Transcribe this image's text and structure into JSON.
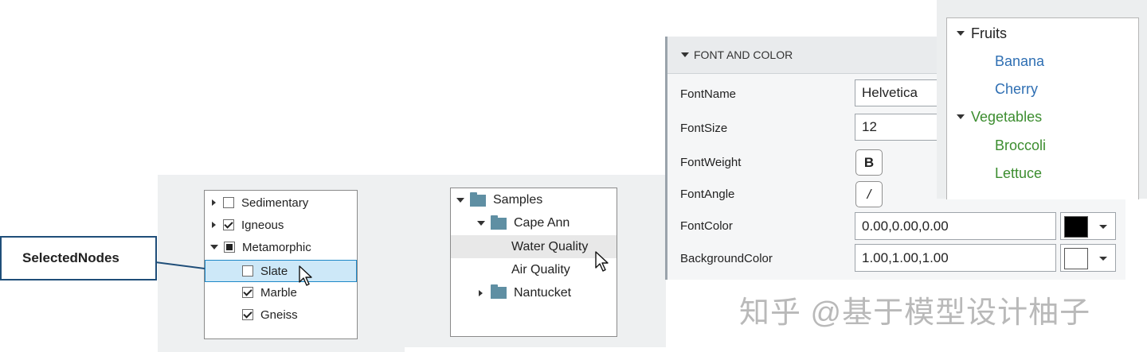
{
  "checkbox_tree": {
    "items": [
      {
        "label": "Sedimentary",
        "state": "unchecked",
        "expander": "collapsed"
      },
      {
        "label": "Igneous",
        "state": "checked",
        "expander": "collapsed"
      },
      {
        "label": "Metamorphic",
        "state": "partial",
        "expander": "expanded"
      },
      {
        "label": "Slate",
        "state": "unchecked",
        "selected": true
      },
      {
        "label": "Marble",
        "state": "checked"
      },
      {
        "label": "Gneiss",
        "state": "checked"
      }
    ],
    "callout": "SelectedNodes"
  },
  "folder_tree": {
    "items": [
      {
        "label": "Samples",
        "expander": "expanded"
      },
      {
        "label": "Cape Ann",
        "expander": "expanded"
      },
      {
        "label": "Water Quality",
        "selected": true
      },
      {
        "label": "Air Quality"
      },
      {
        "label": "Nantucket",
        "expander": "collapsed"
      }
    ]
  },
  "inspector": {
    "section_title": "FONT AND COLOR",
    "props": {
      "font_name": {
        "label": "FontName",
        "value": "Helvetica"
      },
      "font_size": {
        "label": "FontSize",
        "value": "12"
      },
      "font_weight": {
        "label": "FontWeight",
        "button": "B"
      },
      "font_angle": {
        "label": "FontAngle",
        "button": "/"
      },
      "font_color": {
        "label": "FontColor",
        "value": "0.00,0.00,0.00",
        "swatch": "#000000"
      },
      "background_color": {
        "label": "BackgroundColor",
        "value": "1.00,1.00,1.00",
        "swatch": "#ffffff"
      }
    }
  },
  "fruit_tree": {
    "fruits": {
      "label": "Fruits",
      "children": [
        "Banana",
        "Cherry"
      ]
    },
    "vegetables": {
      "label": "Vegetables",
      "children": [
        "Broccoli",
        "Lettuce"
      ]
    }
  },
  "watermark": "知乎 @基于模型设计柚子",
  "colors": {
    "selection": "#cde8f8",
    "selection_border": "#1e88c7",
    "hover_row": "#e8e8e8",
    "fruit_text": "#2f6fb3",
    "vegetable_text": "#3c8d2f",
    "callout_border": "#1f4e79"
  }
}
